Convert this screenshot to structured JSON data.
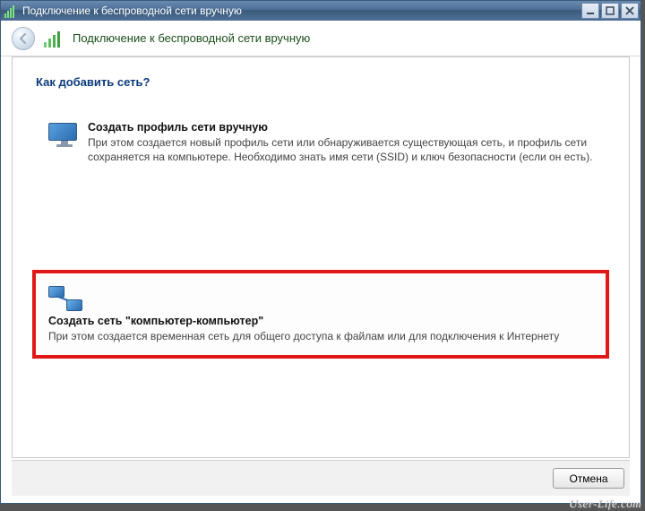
{
  "window": {
    "title": "Подключение к беспроводной сети вручную"
  },
  "header": {
    "title": "Подключение к беспроводной сети вручную"
  },
  "content": {
    "question": "Как добавить сеть?",
    "options": [
      {
        "title": "Создать профиль сети вручную",
        "description": "При этом создается новый профиль сети или обнаруживается существующая сеть, и профиль сети сохраняется на компьютере. Необходимо знать имя сети (SSID) и ключ безопасности (если он есть)."
      },
      {
        "title": "Создать сеть \"компьютер-компьютер\"",
        "description": "При этом создается временная сеть для общего доступа к файлам или для подключения к Интернету"
      }
    ]
  },
  "footer": {
    "cancel": "Отмена"
  },
  "watermark": "User-Life.com"
}
